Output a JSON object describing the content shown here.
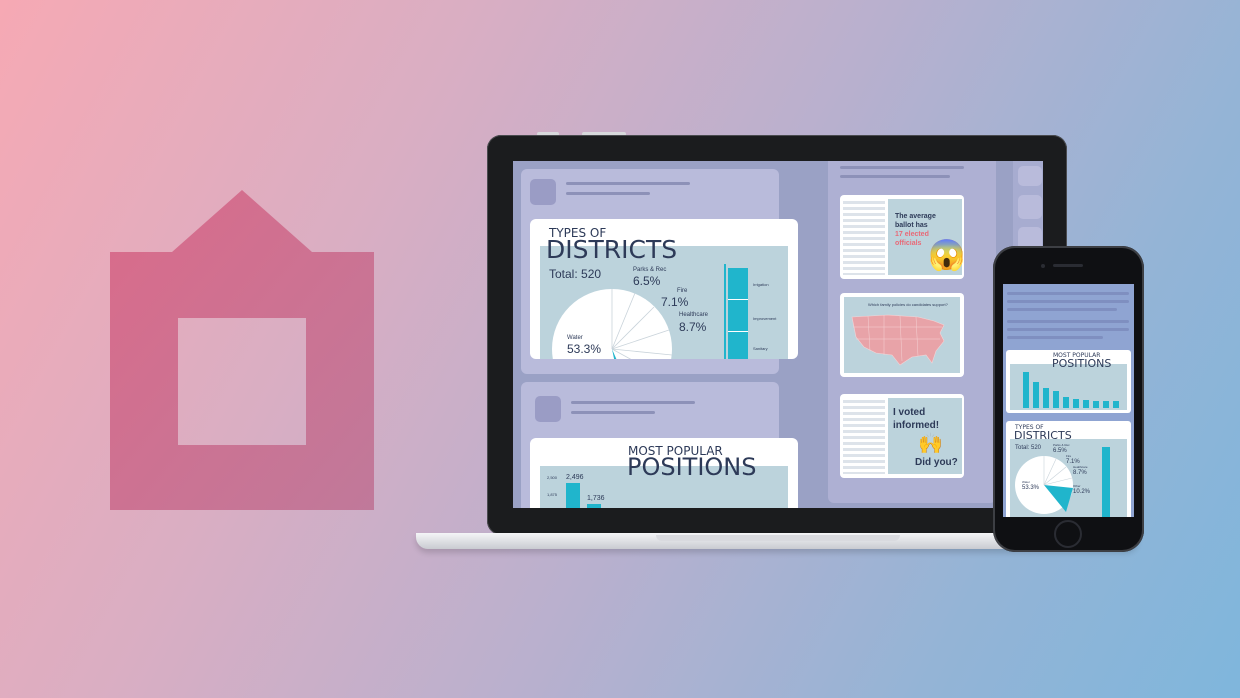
{
  "colors": {
    "logo": "#d06d8d",
    "accent": "#20b5cc",
    "title": "#2d3a58"
  },
  "laptop": {
    "districts": {
      "title_small": "TYPES OF",
      "title_big": "DISTRICTS",
      "total": "Total: 520",
      "slices": [
        {
          "name": "Parks & Rec",
          "pct": "6.5%"
        },
        {
          "name": "Fire",
          "pct": "7.1%"
        },
        {
          "name": "Healthcare",
          "pct": "8.7%"
        },
        {
          "name": "Water",
          "pct": "53.3%"
        }
      ],
      "bar_labels": [
        "Irrigation",
        "Improvement",
        "Sanitary"
      ]
    },
    "positions": {
      "title_small": "MOST POPULAR",
      "title_big": "POSITIONS",
      "values": [
        "2,496",
        "1,736"
      ],
      "axis": [
        "2,500",
        "1,875"
      ]
    },
    "thumbs": {
      "ballot_line1": "The average",
      "ballot_line2": "ballot has",
      "ballot_line3": "17 elected",
      "ballot_line4": "officials",
      "emoji_scream": "😱",
      "map_question": "Which family policies do candidates support?",
      "voted_line1": "I voted",
      "voted_line2": "informed!",
      "voted_emoji": "🙌",
      "voted_line3": "Did you?"
    }
  },
  "phone": {
    "positions_small": "MOST POPULAR",
    "positions_big": "POSITIONS",
    "districts_small": "TYPES OF",
    "districts_big": "DISTRICTS",
    "total": "Total: 520",
    "slices": [
      {
        "name": "Parks & Rec",
        "pct": "6.5%"
      },
      {
        "name": "Fire",
        "pct": "7.1%"
      },
      {
        "name": "Healthcare",
        "pct": "8.7%"
      },
      {
        "name": "Water",
        "pct": "53.3%"
      },
      {
        "name": "Other",
        "pct": "10.2%"
      }
    ]
  }
}
